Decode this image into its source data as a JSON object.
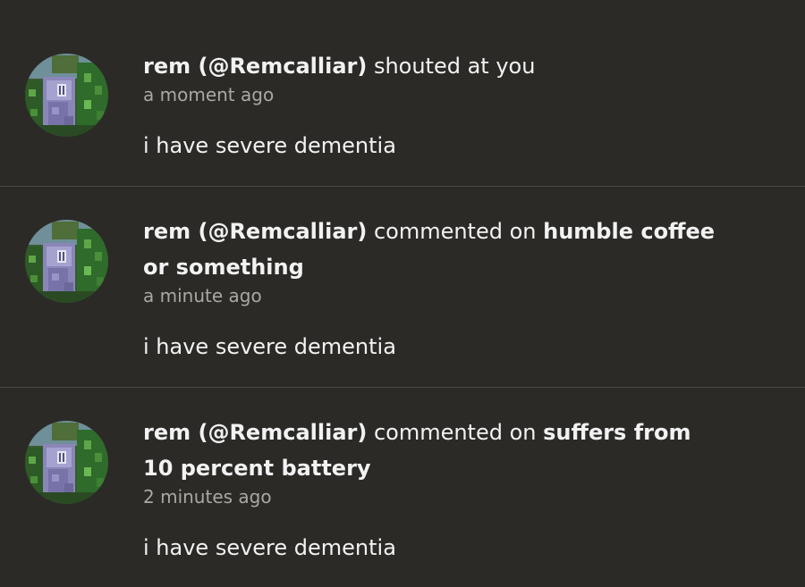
{
  "notifications": [
    {
      "user": "rem (@Remcalliar)",
      "action": " shouted at you",
      "target": "",
      "time": "a moment ago",
      "message": "i have severe dementia"
    },
    {
      "user": "rem (@Remcalliar)",
      "action": " commented on ",
      "target": "humble coffee or something",
      "time": "a minute ago",
      "message": "i have severe dementia"
    },
    {
      "user": "rem (@Remcalliar)",
      "action": " commented on ",
      "target": "suffers from 10 percent battery",
      "time": "2 minutes ago",
      "message": "i have severe dementia"
    }
  ],
  "colors": {
    "background": "#2b2a27",
    "divider": "#4a4946",
    "text": "#f2f2f2",
    "muted": "#a9a8a4"
  },
  "icons": {
    "avatar": "minecraft-avatar-icon"
  }
}
